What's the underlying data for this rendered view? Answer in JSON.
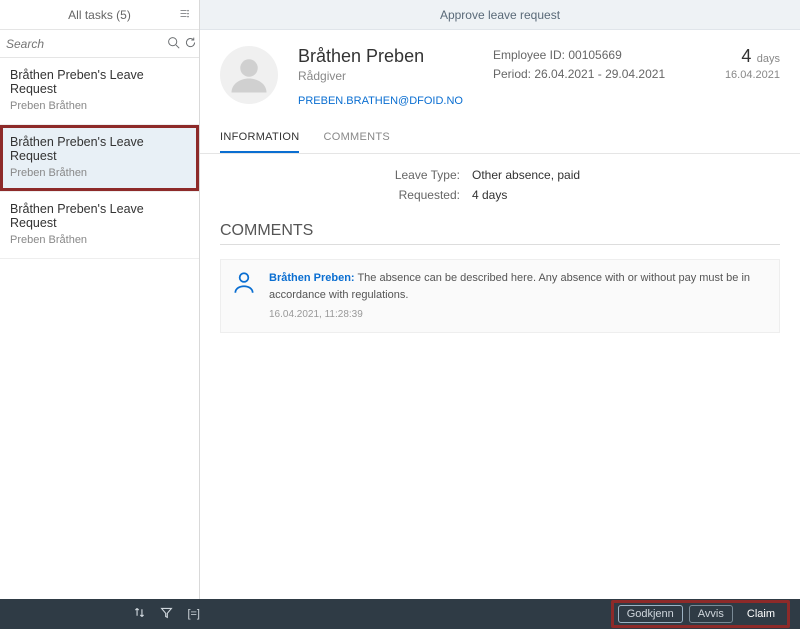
{
  "sidebar": {
    "header": "All tasks (5)",
    "search_placeholder": "Search",
    "items": [
      {
        "title": "Bråthen Preben's Leave Request",
        "sub": "Preben Bråthen"
      },
      {
        "title": "Bråthen Preben's Leave Request",
        "sub": "Preben Bråthen"
      },
      {
        "title": "Bråthen Preben's Leave Request",
        "sub": "Preben Bråthen"
      }
    ]
  },
  "content": {
    "page_title": "Approve leave request",
    "employee": {
      "name": "Bråthen Preben",
      "role": "Rådgiver",
      "email": "PREBEN.BRATHEN@DFOID.NO",
      "id_label": "Employee ID: 00105669",
      "period_label": "Period: 26.04.2021 - 29.04.2021",
      "days_num": "4",
      "days_unit": "days",
      "date": "16.04.2021"
    },
    "tabs": {
      "info": "INFORMATION",
      "comments": "COMMENTS"
    },
    "info": {
      "leave_type_lbl": "Leave Type:",
      "leave_type_val": "Other absence, paid",
      "requested_lbl": "Requested:",
      "requested_val": "4 days"
    },
    "comments": {
      "title": "COMMENTS",
      "author": "Bråthen Preben:",
      "text": "The absence can be described here. Any absence with or without pay must be in accordance with regulations.",
      "date": "16.04.2021, 11:28:39"
    }
  },
  "footer": {
    "approve": "Godkjenn",
    "reject": "Avvis",
    "claim": "Claim"
  }
}
